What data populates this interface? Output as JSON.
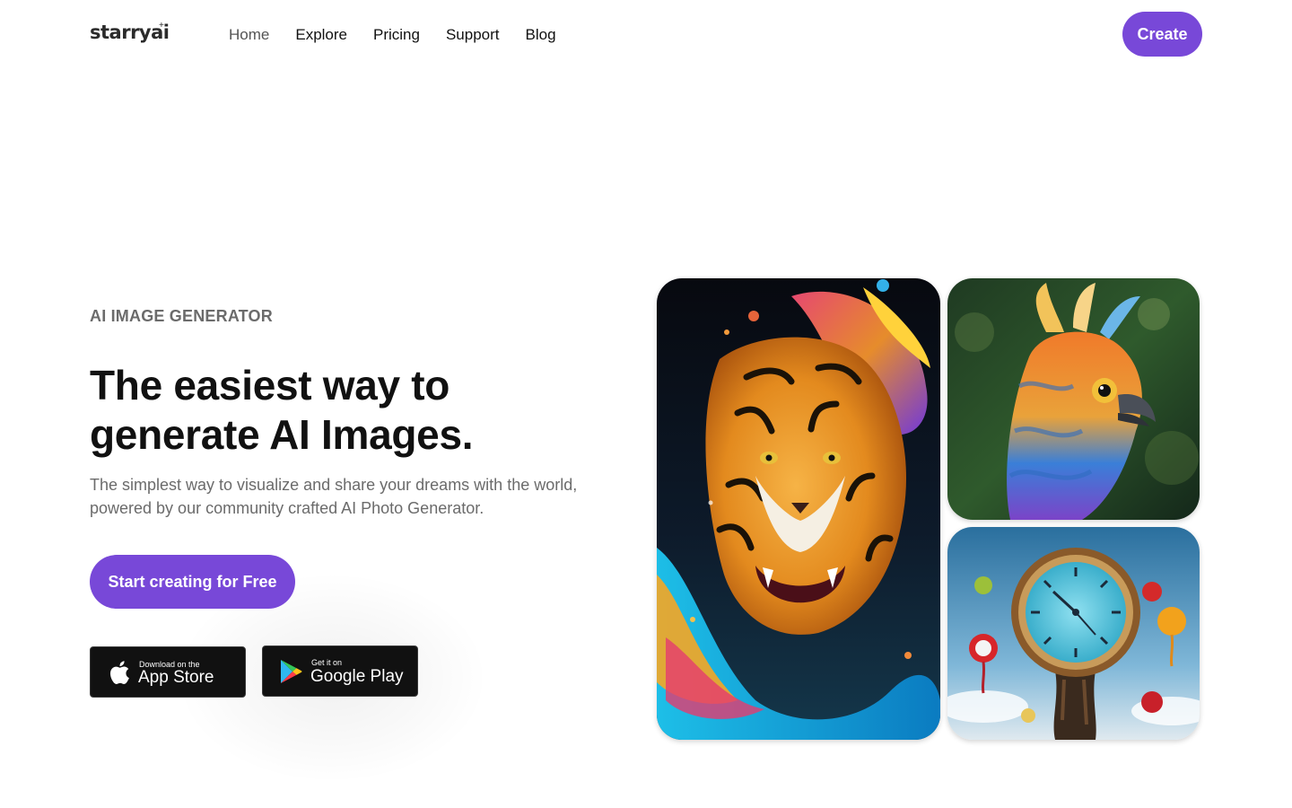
{
  "brand": {
    "name": "starryai",
    "logo_icon": "sparkle-icon"
  },
  "nav": {
    "items": [
      {
        "label": "Home",
        "active": true
      },
      {
        "label": "Explore"
      },
      {
        "label": "Pricing"
      },
      {
        "label": "Support"
      },
      {
        "label": "Blog"
      }
    ],
    "create_label": "Create"
  },
  "hero": {
    "eyebrow": "AI IMAGE GENERATOR",
    "headline": "The easiest way to generate AI Images.",
    "subtext": "The simplest way to visualize and share your dreams with the world, powered by our community crafted AI Photo Generator.",
    "cta_label": "Start creating for Free",
    "app_store": {
      "small": "Download on the",
      "big": "App Store",
      "icon": "apple-icon"
    },
    "google_play": {
      "small": "Get it on",
      "big": "Google Play",
      "icon": "google-play-icon"
    }
  },
  "gallery": {
    "images": [
      {
        "subject": "tiger with paint splash"
      },
      {
        "subject": "colorful bird"
      },
      {
        "subject": "melting clock with apples"
      }
    ]
  },
  "colors": {
    "accent": "#7848d8",
    "text_primary": "#111111",
    "text_muted": "#6b6b6b",
    "badge_bg": "#111111"
  }
}
